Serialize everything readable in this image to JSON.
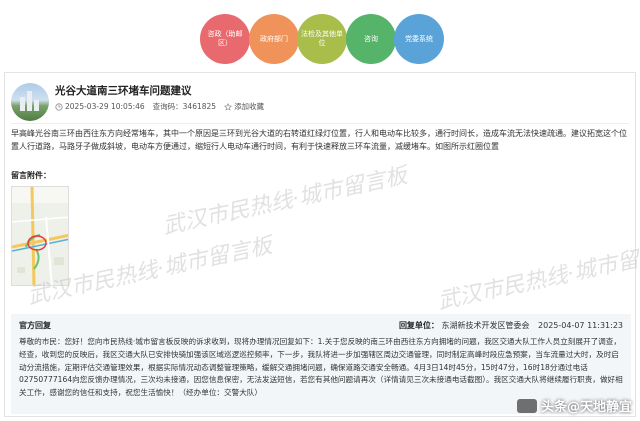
{
  "nav": {
    "items": [
      {
        "label": "咨政（助邮区）",
        "color": "#e96a6e"
      },
      {
        "label": "政府部门",
        "color": "#f0935a"
      },
      {
        "label": "法检及其他单位",
        "color": "#a8bd4a"
      },
      {
        "label": "咨询",
        "color": "#55b36a"
      },
      {
        "label": "党委系统",
        "color": "#5aa3d9"
      }
    ]
  },
  "post": {
    "title": "光谷大道南三环堵车问题建议",
    "datetime": "2025-03-29 10:05:46",
    "query_code_label": "查询码：",
    "query_code": "3461825",
    "collect_label": "添加收藏",
    "content": "早高峰光谷南三环由西往东方向经常堵车，其中一个原因是三环到光谷大道的右转道红绿灯位置，行人和电动车比较多，通行时间长，造成车流无法快速疏通。建议拓宽这个位置人行道路，马路牙子做成斜坡，电动车方便通过，缩短行人电动车通行时间，有利于快速释放三环车流量，减缓堵车。如图所示红圈位置",
    "attachment_label": "留言附件："
  },
  "watermark": {
    "text": "武汉市民热线·城市留言板"
  },
  "reply": {
    "label": "官方回复",
    "unit_label": "回复单位：",
    "unit": "东湖新技术开发区管委会",
    "time": "2025-04-07 11:31:23",
    "body": "尊敬的市民：您好！您向市民热线·城市留言板反映的诉求收到，现将办理情况回复如下：1.关于您反映的南三环由西往东方向拥堵的问题，我区交通大队工作人员立刻展开了调查，经查，收到您的反映后，我区交通大队已安排快骑加强该区域巡逻巡控频率，下一步，我队将进一步加强辖区周边交通管理，同时制定高峰时段应急预案，当车流量过大时，及时启动分流措施，定期评估交通管理效果，根据实际情况动态调整管理策略，缓解交通拥堵问题，确保道路交通安全畅通。4月3日14时45分，15时47分，16时18分通过电话02750777164向您反馈办理情况，三次均未接通，因您信息保密，无法发送短信，若您有其他问题请再次（详情请见三次未接通电话截图）。我区交通大队将继续履行职责，做好相关工作，感谢您的信任和支持，祝您生活愉快！（经办单位：交警大队）"
  },
  "credit": {
    "text": "头条@天地静宜"
  }
}
